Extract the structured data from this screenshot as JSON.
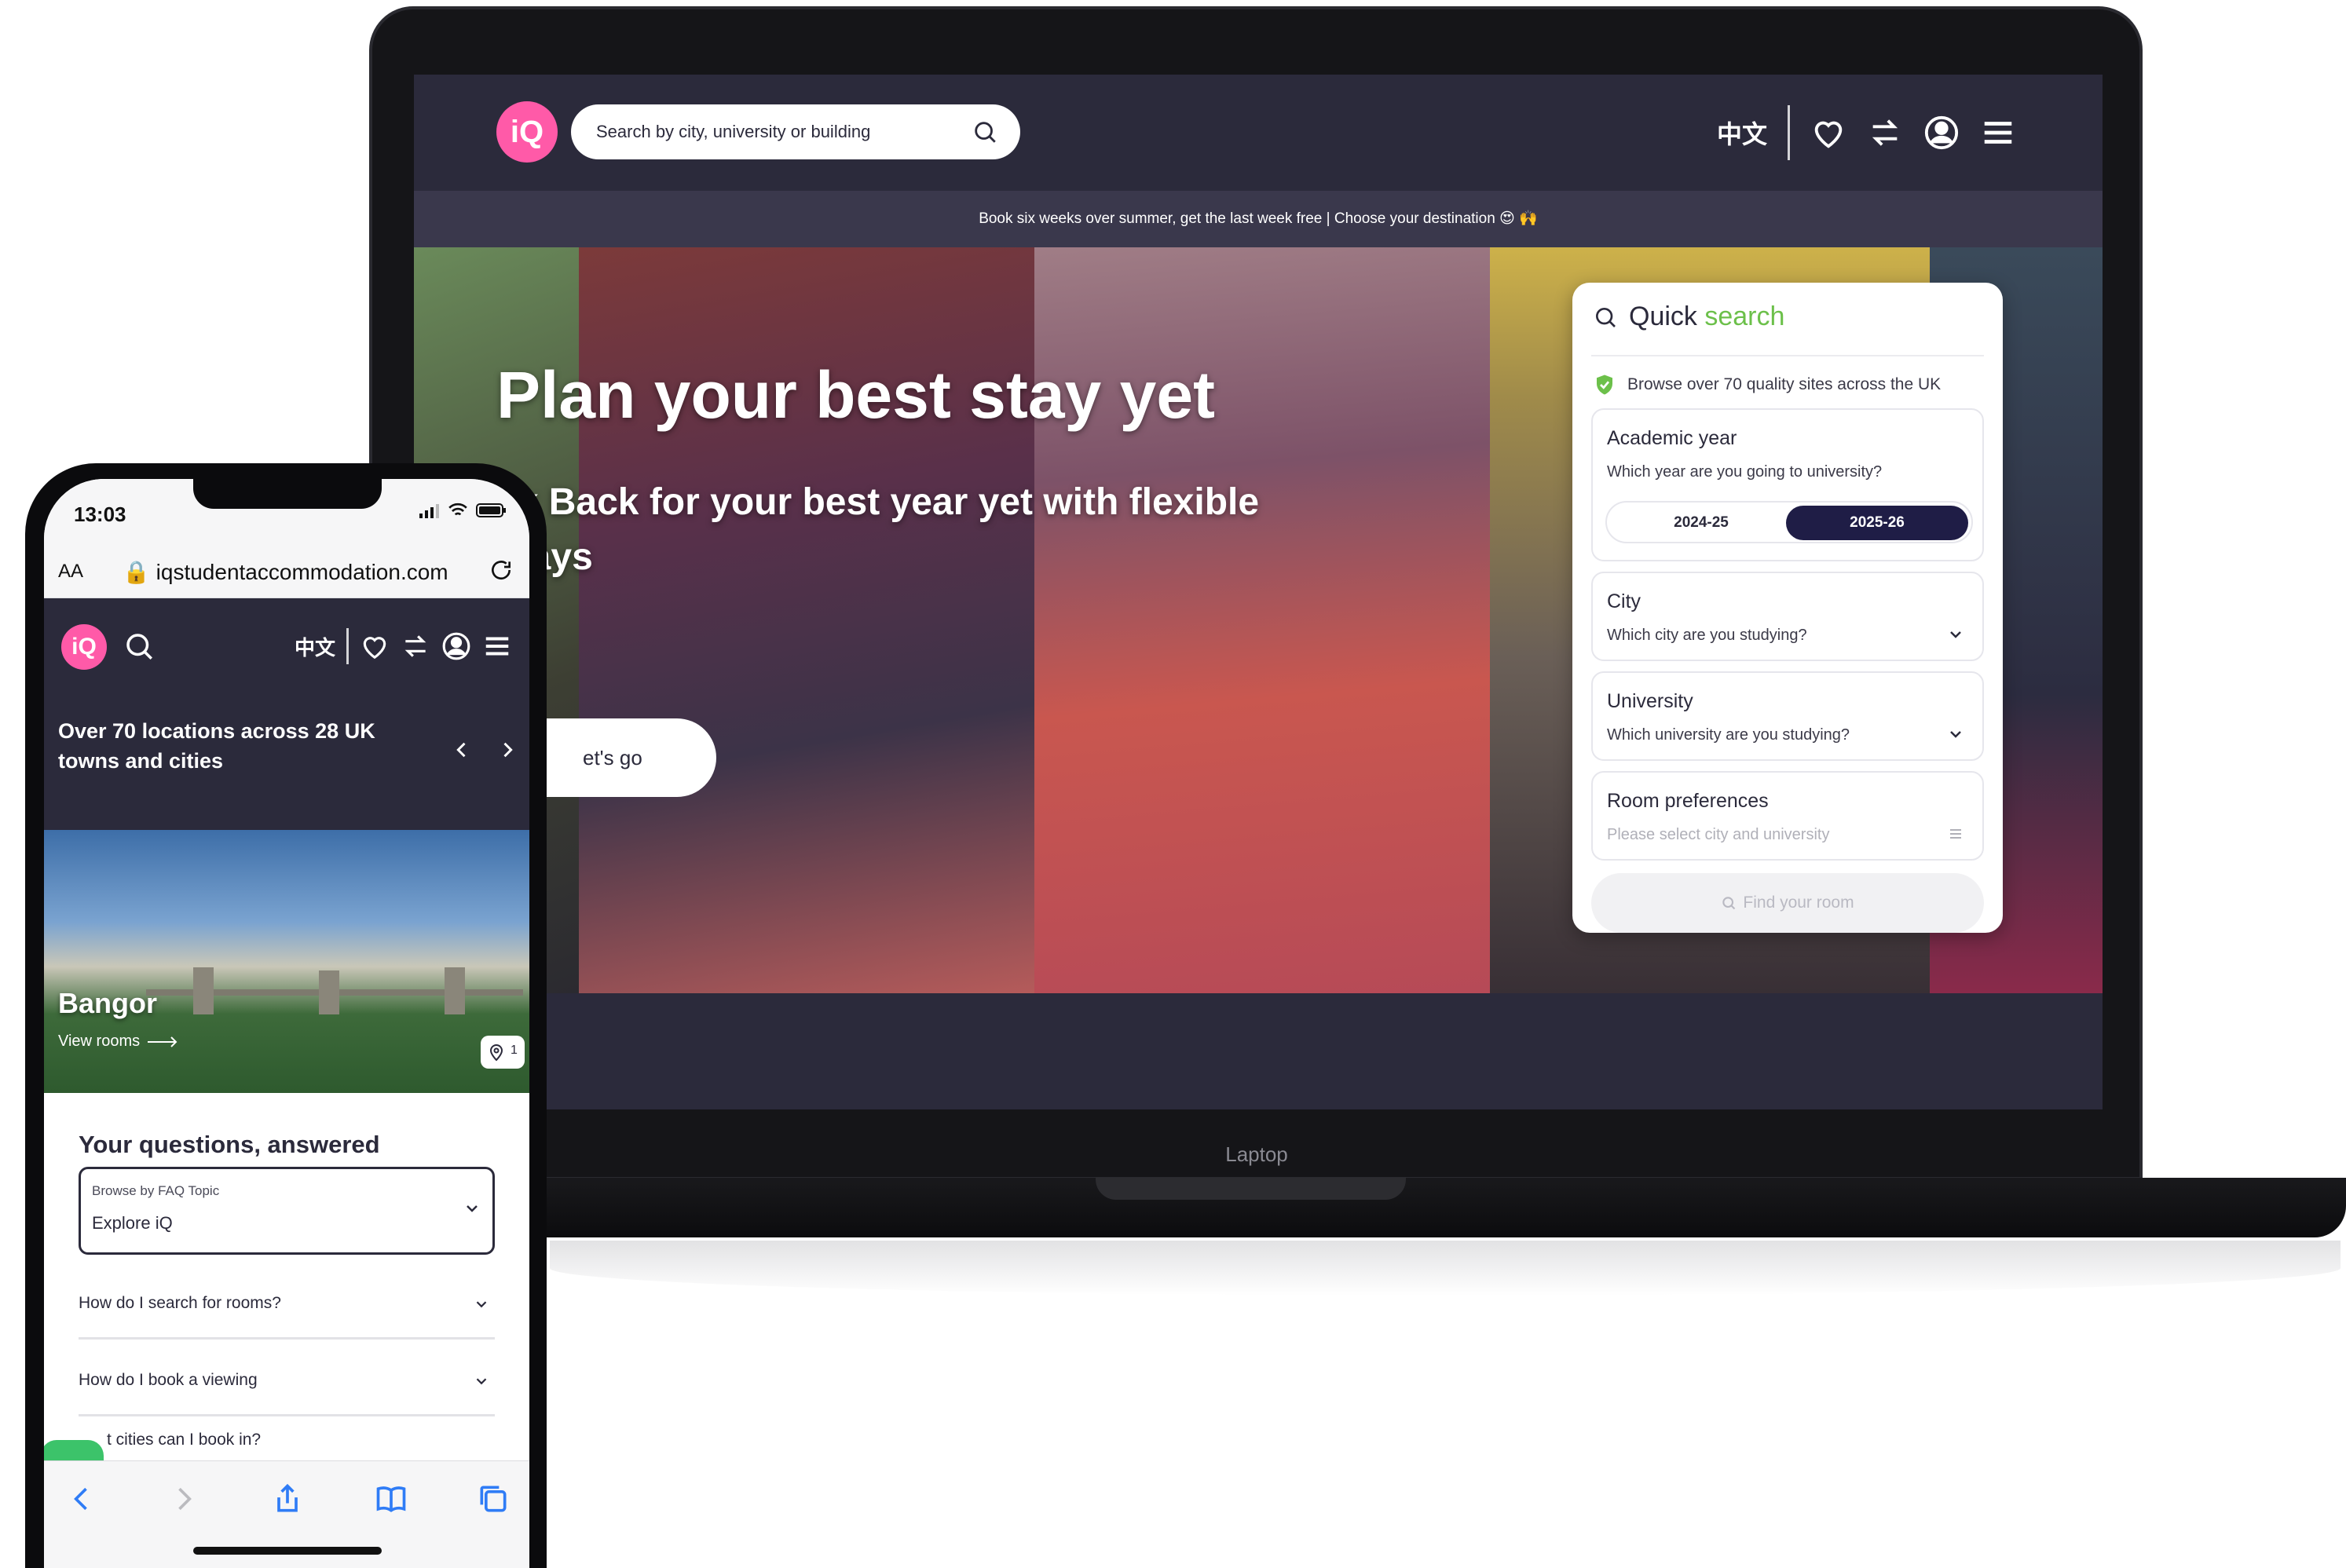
{
  "laptop": {
    "label": "Laptop",
    "header": {
      "logo_text": "iQ",
      "search_placeholder": "Search by city, university or building",
      "lang": "中文"
    },
    "promo_banner": "Book six weeks over summer, get the last week free | Choose your destination 😍 🙌",
    "hero": {
      "headline": "Plan your best stay yet",
      "subline": "ck Back for your best year yet with flexible stays",
      "cta": "et's go"
    },
    "quick_search": {
      "title_prefix": "Quick ",
      "title_accent": "search",
      "trust_text": "Browse over 70 quality sites across the UK",
      "academic_year": {
        "label": "Academic year",
        "hint": "Which year are you going to university?",
        "options": [
          "2024-25",
          "2025-26"
        ],
        "selected": "2025-26"
      },
      "city": {
        "label": "City",
        "hint": "Which city are you studying?"
      },
      "university": {
        "label": "University",
        "hint": "Which university are you studying?"
      },
      "room_preferences": {
        "label": "Room preferences",
        "hint": "Please select city and university"
      },
      "find_button": "Find your room"
    },
    "colors": {
      "header_bg": "#2b2a3b",
      "brand_pink": "#ff5aa8",
      "accent_green": "#6cc04a",
      "selected_year_bg": "#1f1d46"
    }
  },
  "phone": {
    "status": {
      "time": "13:03"
    },
    "browser": {
      "aa": "AA",
      "url": "iqstudentaccommodation.com"
    },
    "nav": {
      "logo_text": "iQ",
      "lang": "中文"
    },
    "locations_banner": "Over 70 locations across 28 UK towns and cities",
    "featured_city": {
      "name": "Bangor",
      "link": "View rooms",
      "pin_count": "1"
    },
    "faq": {
      "title": "Your questions, answered",
      "select_label": "Browse by FAQ Topic",
      "select_value": "Explore iQ",
      "items": [
        "How do I search for rooms?",
        "How do I book a viewing",
        "t cities can I book in?"
      ]
    },
    "toolbar_icons": [
      "back-icon",
      "forward-icon",
      "share-icon",
      "bookmarks-icon",
      "tabs-icon"
    ]
  }
}
